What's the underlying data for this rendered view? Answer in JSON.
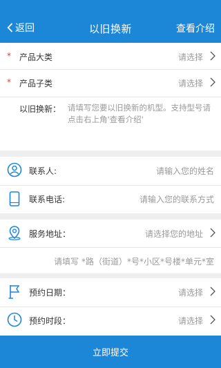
{
  "header": {
    "back_label": "返回",
    "title": "以旧换新",
    "intro_label": "查看介绍"
  },
  "product": {
    "category": {
      "required_mark": "*",
      "label": "产品大类",
      "placeholder": "请选择"
    },
    "subcategory": {
      "required_mark": "*",
      "label": "产品子类",
      "placeholder": "请选择"
    },
    "trade_in": {
      "label": "以旧换新：",
      "placeholder": "请填写您要以旧换新的机型。支持型号请点击右上角'查看介绍'"
    }
  },
  "contact": {
    "name": {
      "label": "联系人:",
      "placeholder": "请输入您的姓名"
    },
    "phone": {
      "label": "联系电话:",
      "placeholder": "请输入您的联系方式"
    }
  },
  "address": {
    "service": {
      "label": "服务地址：",
      "placeholder": "请选择您的地址"
    },
    "detail_placeholder": "请填写 *路（街道）*号*小区*号楼*单元*室"
  },
  "appointment": {
    "date": {
      "label": "预约日期：",
      "placeholder": "请选择"
    },
    "time": {
      "label": "预约时段：",
      "placeholder": "请选择"
    }
  },
  "submit_label": "立即提交",
  "colors": {
    "primary": "#1d87d7",
    "required": "#e23b3b",
    "placeholder": "#9a9a9a",
    "background": "#eeeeee"
  }
}
